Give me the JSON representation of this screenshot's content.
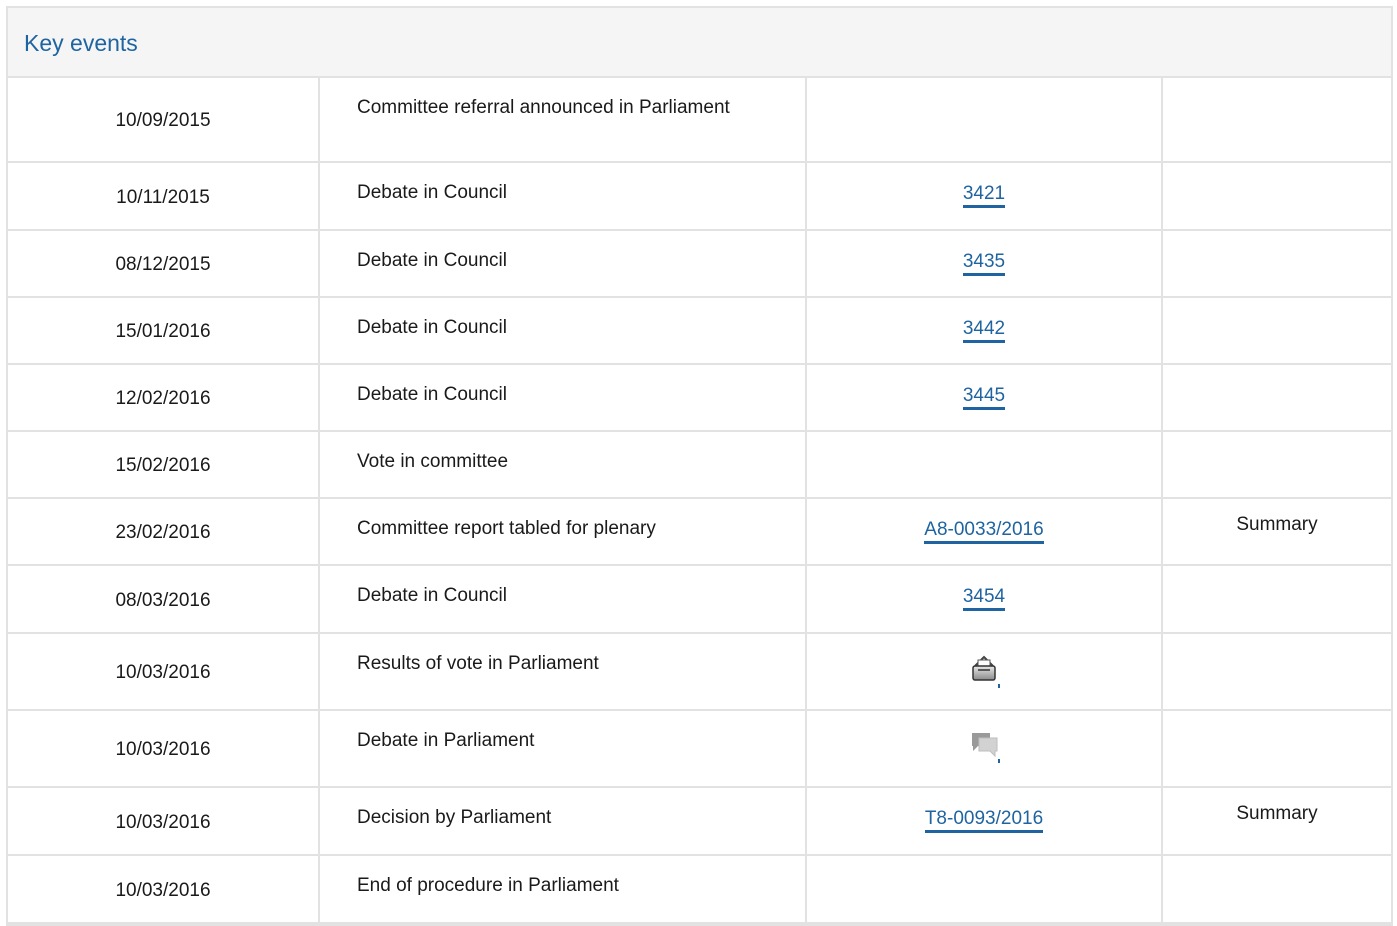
{
  "panel": {
    "title": "Key events"
  },
  "rows": [
    {
      "date": "10/09/2015",
      "event": "Committee referral announced in Parliament",
      "ref": "",
      "summary": ""
    },
    {
      "date": "10/11/2015",
      "event": "Debate in Council",
      "ref": "3421",
      "summary": ""
    },
    {
      "date": "08/12/2015",
      "event": "Debate in Council",
      "ref": "3435",
      "summary": ""
    },
    {
      "date": "15/01/2016",
      "event": "Debate in Council",
      "ref": "3442",
      "summary": ""
    },
    {
      "date": "12/02/2016",
      "event": "Debate in Council",
      "ref": "3445",
      "summary": ""
    },
    {
      "date": "15/02/2016",
      "event": "Vote in committee",
      "ref": "",
      "summary": ""
    },
    {
      "date": "23/02/2016",
      "event": "Committee report tabled for plenary",
      "ref": "A8-0033/2016",
      "summary": "Summary"
    },
    {
      "date": "08/03/2016",
      "event": "Debate in Council",
      "ref": "3454",
      "summary": ""
    },
    {
      "date": "10/03/2016",
      "event": "Results of vote in Parliament",
      "ref_icon": "ballot-box-icon",
      "summary": ""
    },
    {
      "date": "10/03/2016",
      "event": "Debate in Parliament",
      "ref_icon": "speech-bubbles-icon",
      "summary": ""
    },
    {
      "date": "10/03/2016",
      "event": "Decision by Parliament",
      "ref": "T8-0093/2016",
      "summary": "Summary"
    },
    {
      "date": "10/03/2016",
      "event": "End of procedure in Parliament",
      "ref": "",
      "summary": ""
    }
  ],
  "colors": {
    "link": "#1f64a0",
    "border": "#e2e2e2",
    "header_bg": "#f5f5f5"
  }
}
